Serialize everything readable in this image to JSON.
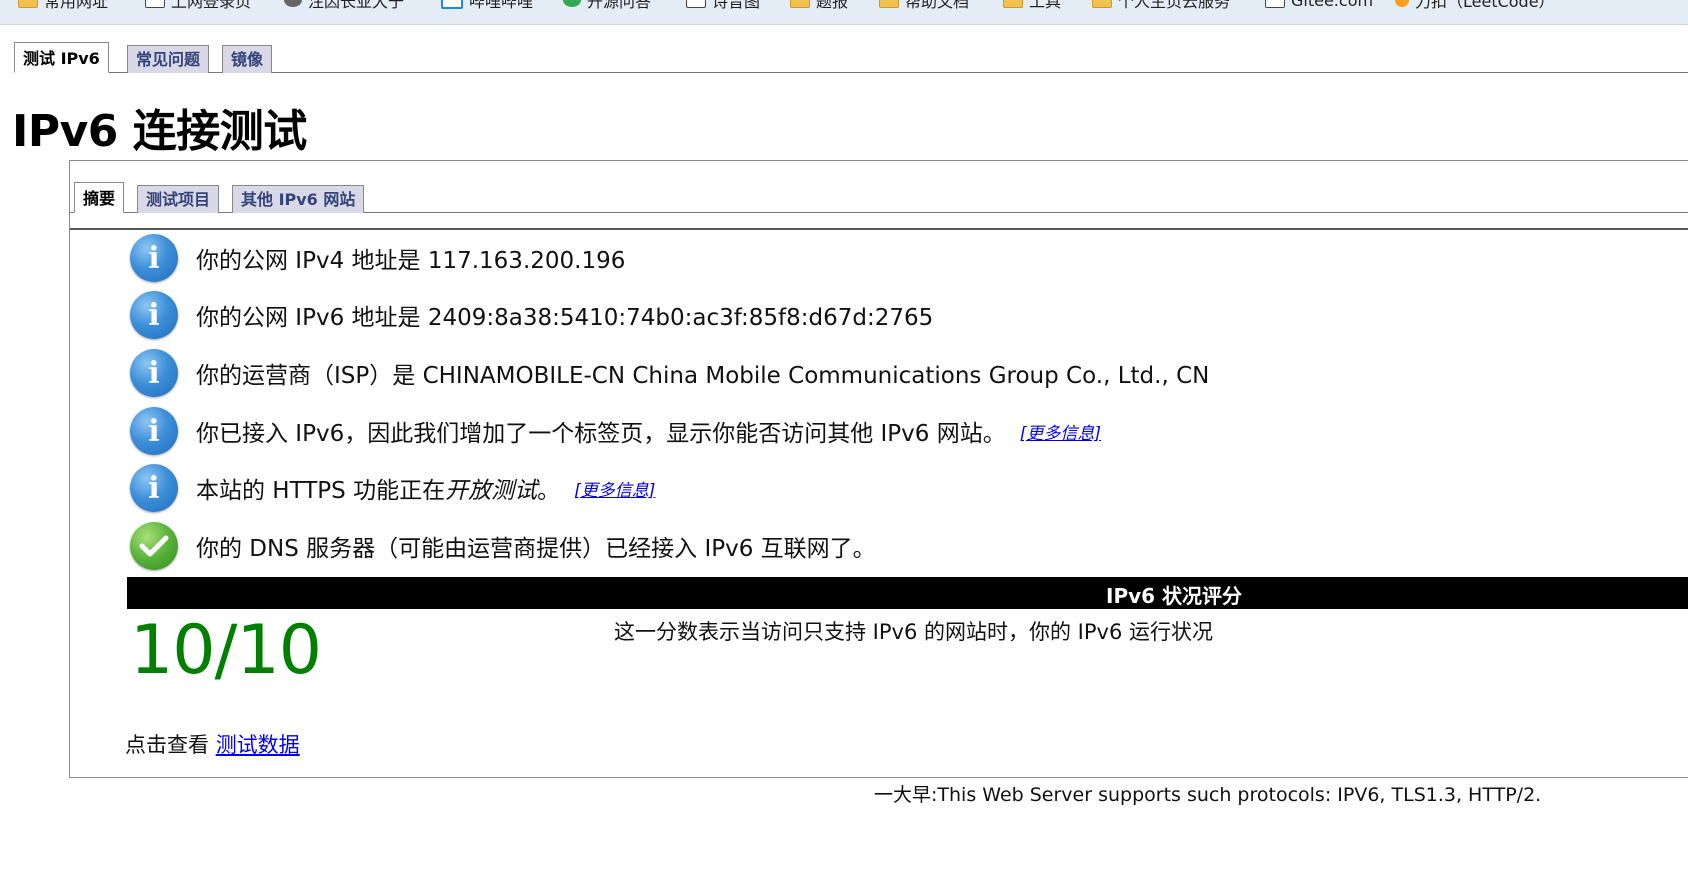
{
  "bookmarks": [
    {
      "label": "常用网址",
      "icon": "folder-icon"
    },
    {
      "label": "上网登录页",
      "icon": "page-icon"
    },
    {
      "label": "注因长亚大于",
      "icon": "globe-icon"
    },
    {
      "label": "哔哩哔哩",
      "icon": "bilibili-icon"
    },
    {
      "label": "开源问答",
      "icon": "circle-icon"
    },
    {
      "label": "诗音图",
      "icon": "quill-icon"
    },
    {
      "label": "题报",
      "icon": "folder-icon"
    },
    {
      "label": "帮助文档",
      "icon": "folder-icon"
    },
    {
      "label": "工具",
      "icon": "folder-icon"
    },
    {
      "label": "个人主页云服务",
      "icon": "folder-icon"
    },
    {
      "label": "Gitee.com",
      "icon": "page-icon"
    },
    {
      "label": "力扣（LeetCode）",
      "icon": "leetcode-icon"
    }
  ],
  "top_tabs": [
    "测试 IPv6",
    "常见问题",
    "镜像"
  ],
  "page_title": "IPv6 连接测试",
  "sub_tabs": [
    "摘要",
    "测试项目",
    "其他 IPv6 网站"
  ],
  "rows": [
    {
      "text": "你的公网 IPv4 地址是 117.163.200.196"
    },
    {
      "text": "你的公网 IPv6 地址是 2409:8a38:5410:74b0:ac3f:85f8:d67d:2765"
    },
    {
      "text": "你的运营商（ISP）是 CHINAMOBILE-CN China Mobile Communications Group Co., Ltd., CN"
    },
    {
      "text": "你已接入 IPv6，因此我们增加了一个标签页，显示你能否访问其他 IPv6 网站。",
      "link": "[更多信息]"
    },
    {
      "text_before": "本站的 HTTPS 功能正在",
      "text_italic": "开放测试",
      "text_after": "。",
      "link": "[更多信息]"
    },
    {
      "text": "你的 DNS 服务器（可能由运营商提供）已经接入 IPv6 互联网了。"
    }
  ],
  "score": {
    "header": "IPv6 状况评分",
    "value": "10/10",
    "description": "这一分数表示当访问只支持 IPv6 的网站时，你的 IPv6 运行状况",
    "color": "#008000"
  },
  "details": {
    "prefix": "点击查看",
    "link": "测试数据"
  },
  "footer": "一大早:This Web Server supports such protocols: IPV6, TLS1.3, HTTP/2."
}
